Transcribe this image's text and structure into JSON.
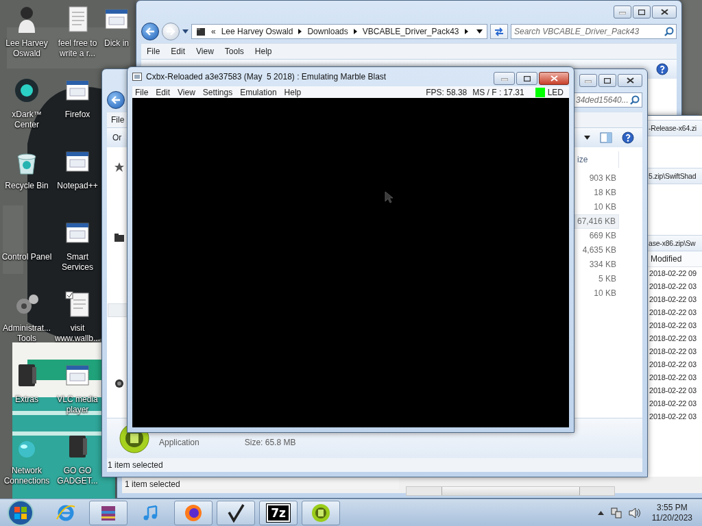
{
  "desktop": {
    "icons": [
      {
        "label": "Lee Harvey Oswald",
        "kind": "figure"
      },
      {
        "label": "xDark™ Center",
        "kind": "orb"
      },
      {
        "label": "Recycle Bin",
        "kind": "bin"
      },
      {
        "label": "Control Panel",
        "kind": "none"
      },
      {
        "label": "Administrat... Tools",
        "kind": "gears"
      },
      {
        "label": "Extras",
        "kind": "binder"
      },
      {
        "label": "Network Connections",
        "kind": "globe"
      },
      {
        "label": "feel free to write a r...",
        "kind": "document"
      },
      {
        "label": "Firefox",
        "kind": "app"
      },
      {
        "label": "Notepad++",
        "kind": "app"
      },
      {
        "label": "Smart Services",
        "kind": "app"
      },
      {
        "label": "visit www.wallb...",
        "kind": "checkdoc"
      },
      {
        "label": "VLC media player",
        "kind": "app"
      },
      {
        "label": "GO GO GADGET...",
        "kind": "binder"
      },
      {
        "label": "Dick in",
        "kind": "app"
      }
    ]
  },
  "explorer_back": {
    "address": {
      "overflow": "«",
      "crumbs": [
        "Lee Harvey Oswald",
        "Downloads",
        "VBCABLE_Driver_Pack43"
      ]
    },
    "search": {
      "placeholder": "Search VBCABLE_Driver_Pack43"
    },
    "menu": [
      "File",
      "Edit",
      "View",
      "Tools",
      "Help"
    ]
  },
  "explorer_right": {
    "paths": [
      "-Release-x64.zi",
      "5.zip\\SwiftShad",
      "ase-x86.zip\\Sw"
    ],
    "columns": [
      "Modified"
    ],
    "rows": [
      "2018-02-22 09",
      "2018-02-22 03",
      "2018-02-22 03",
      "2018-02-22 03",
      "2018-02-22 03",
      "2018-02-22 03",
      "2018-02-22 03",
      "2018-02-22 03",
      "2018-02-22 03",
      "2018-02-22 03",
      "2018-02-22 03",
      "2018-02-22 03"
    ],
    "status": "1 item selected"
  },
  "explorer_front": {
    "search": {
      "placeholder": "34ded15640..."
    },
    "menu": [
      "File"
    ],
    "toolbar": [
      "Or"
    ],
    "columns": [
      "ize"
    ],
    "rows": [
      {
        "size": "903 KB",
        "selected": false
      },
      {
        "size": "18 KB",
        "selected": false
      },
      {
        "size": "10 KB",
        "selected": false
      },
      {
        "size": "67,416 KB",
        "selected": true
      },
      {
        "size": "669 KB",
        "selected": false
      },
      {
        "size": "4,635 KB",
        "selected": false
      },
      {
        "size": "334 KB",
        "selected": false
      },
      {
        "size": "5 KB",
        "selected": false
      },
      {
        "size": "10 KB",
        "selected": false
      }
    ],
    "details": {
      "type": "Application",
      "size": "Size: 65.8 MB"
    },
    "status": "1 item selected"
  },
  "emulator": {
    "title": "Cxbx-Reloaded a3e37583 (May  5 2018) : Emulating Marble Blast",
    "menu": [
      "File",
      "Edit",
      "View",
      "Settings",
      "Emulation",
      "Help"
    ],
    "fps": "FPS: 58.38",
    "frame_time": "MS / F : 17.31",
    "led": {
      "label": "LED",
      "color": "#00ff00"
    }
  },
  "taskbar": {
    "apps": [
      {
        "kind": "ie",
        "running": false
      },
      {
        "kind": "archive",
        "running": true
      },
      {
        "kind": "music",
        "running": false
      },
      {
        "kind": "firefox",
        "running": true
      },
      {
        "kind": "check",
        "running": true
      },
      {
        "kind": "sevenzip",
        "label": "7z",
        "running": true
      },
      {
        "kind": "cxbx",
        "running": true
      }
    ],
    "time": "3:55 PM",
    "date": "11/20/2023"
  }
}
